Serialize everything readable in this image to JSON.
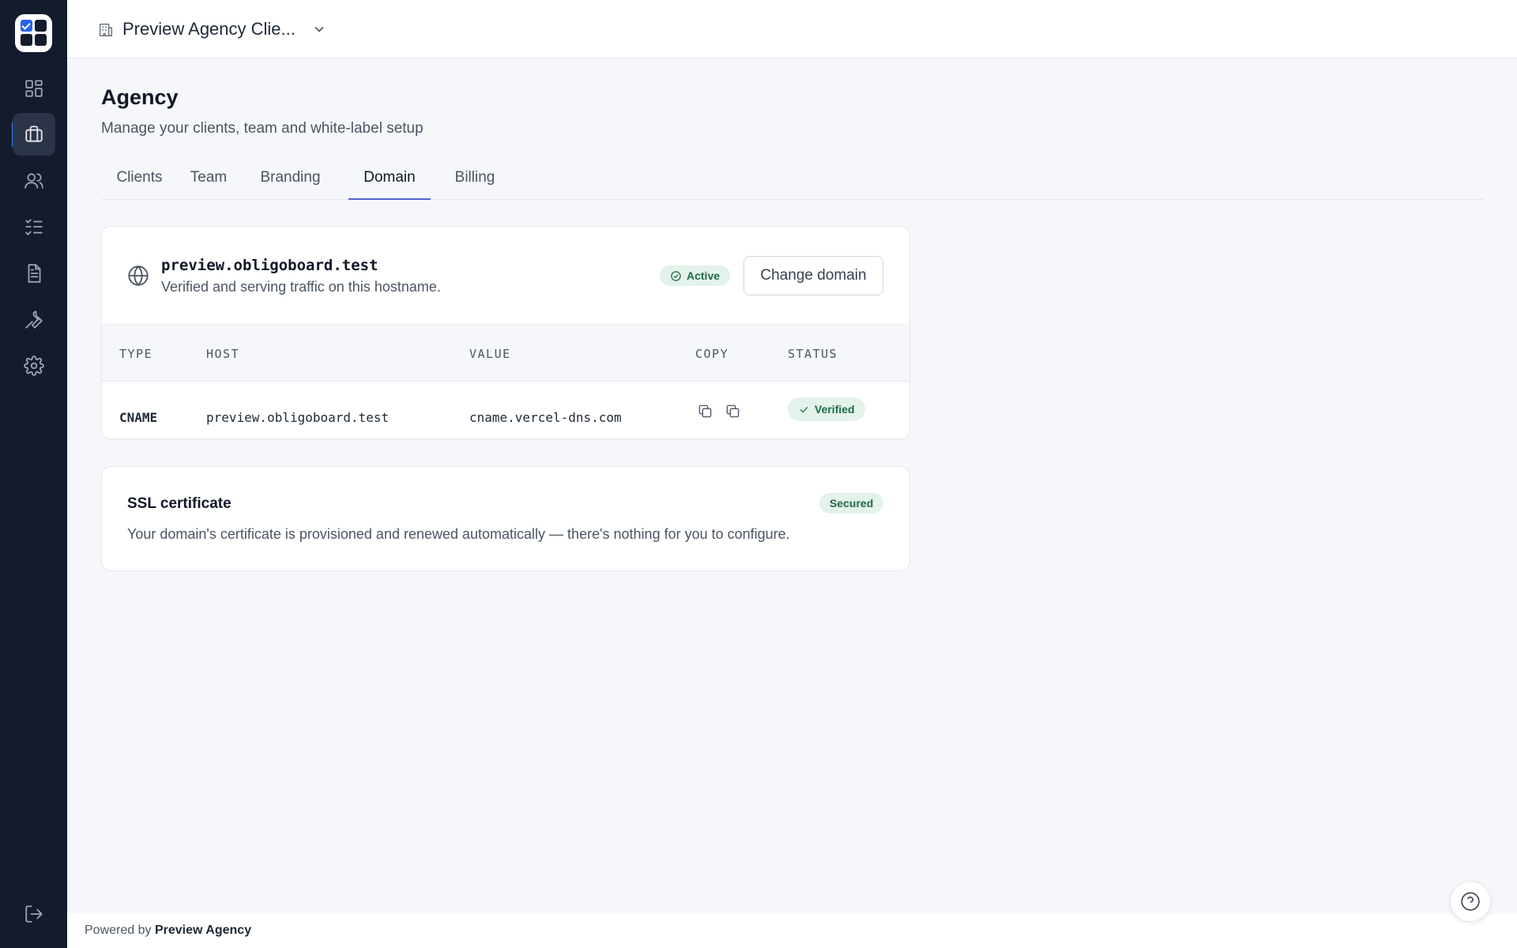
{
  "header": {
    "org_name": "Preview Agency Clie..."
  },
  "sidebar": {
    "items": [
      {
        "icon": "dashboard-icon",
        "active": false
      },
      {
        "icon": "briefcase-icon",
        "active": true
      },
      {
        "icon": "users-icon",
        "active": false
      },
      {
        "icon": "checklist-icon",
        "active": false
      },
      {
        "icon": "document-icon",
        "active": false
      },
      {
        "icon": "wrench-icon",
        "active": false
      },
      {
        "icon": "gear-icon",
        "active": false
      }
    ],
    "bottom_icon": "logout-icon"
  },
  "page": {
    "title": "Agency",
    "subtitle": "Manage your clients, team and white-label setup"
  },
  "tabs": [
    {
      "label": "Clients"
    },
    {
      "label": "Team"
    },
    {
      "label": "Branding"
    },
    {
      "label": "Domain",
      "active": true
    },
    {
      "label": "Billing"
    }
  ],
  "domain": {
    "hostname": "preview.obligoboard.test",
    "description": "Verified and serving traffic on this hostname.",
    "status_badge": "Active",
    "change_button": "Change domain",
    "table": {
      "headers": [
        "TYPE",
        "HOST",
        "VALUE",
        "COPY",
        "STATUS"
      ],
      "rows": [
        {
          "type": "CNAME",
          "host": "preview.obligoboard.test",
          "value": "cname.vercel-dns.com",
          "status": "Verified"
        }
      ]
    }
  },
  "ssl": {
    "title": "SSL certificate",
    "description": "Your domain's certificate is provisioned and renewed automatically — there's nothing for you to configure.",
    "badge": "Secured"
  },
  "footer": {
    "prefix": "Powered by",
    "brand": "Preview Agency"
  },
  "colors": {
    "sidebar_bg": "#141b2d",
    "accent": "#4f63d2",
    "success_bg": "#e3f2ea",
    "success_text": "#1d6b45"
  }
}
